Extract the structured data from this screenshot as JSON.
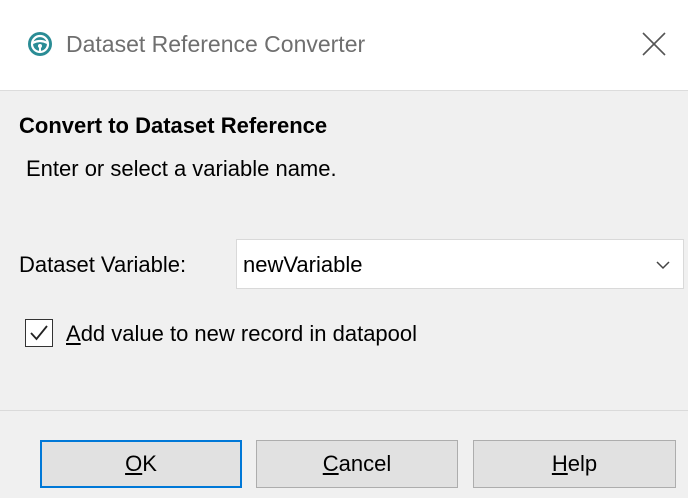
{
  "window": {
    "title": "Dataset Reference Converter",
    "icon": "steering-wheel-icon",
    "close_icon": "close-icon"
  },
  "main": {
    "heading": "Convert to Dataset Reference",
    "instruction": "Enter or select a variable name.",
    "variable_label": "Dataset Variable:",
    "variable_value": "newVariable",
    "checkbox": {
      "checked": true,
      "label_mnemonic": "A",
      "label_rest": "dd value to new record in datapool"
    }
  },
  "buttons": {
    "ok": {
      "mnemonic": "O",
      "rest": "K"
    },
    "cancel": {
      "mnemonic": "C",
      "rest": "ancel"
    },
    "help": {
      "mnemonic": "H",
      "rest": "elp"
    }
  },
  "colors": {
    "accent": "#0078d7",
    "icon_teal": "#2a8c95",
    "dialog_bg": "#f0f0f0"
  }
}
